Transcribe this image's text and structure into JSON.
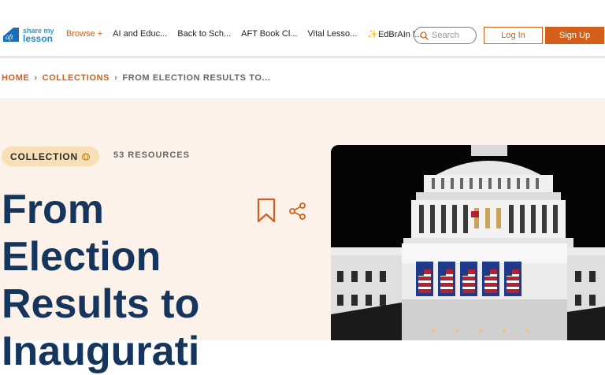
{
  "logo": {
    "line1": "share my",
    "line2": "lesson"
  },
  "nav": {
    "browse": "Browse +",
    "items": [
      "AI and Educ...",
      "Back to Sch...",
      "AFT Book Cl...",
      "Vital Lesso...",
      "✨EdBrAIn l..."
    ]
  },
  "search": {
    "placeholder": "Search",
    "icon": "search-icon"
  },
  "auth": {
    "login": "Log In",
    "signup": "Sign Up"
  },
  "breadcrumb": {
    "home": "HOME",
    "collections": "COLLECTIONS",
    "current": "FROM ELECTION RESULTS TO...",
    "separator": "›"
  },
  "hero": {
    "badge": "COLLECTION",
    "count": "53 RESOURCES",
    "title_lines": [
      "From",
      "Election",
      "Results to",
      "Inaugurati"
    ],
    "image_alt": "U.S. Capitol dome at night with flags"
  },
  "colors": {
    "accent": "#d35f1a",
    "title": "#16355c",
    "hero_bg": "#fdf2ea",
    "badge_bg": "#f8dfb5"
  }
}
